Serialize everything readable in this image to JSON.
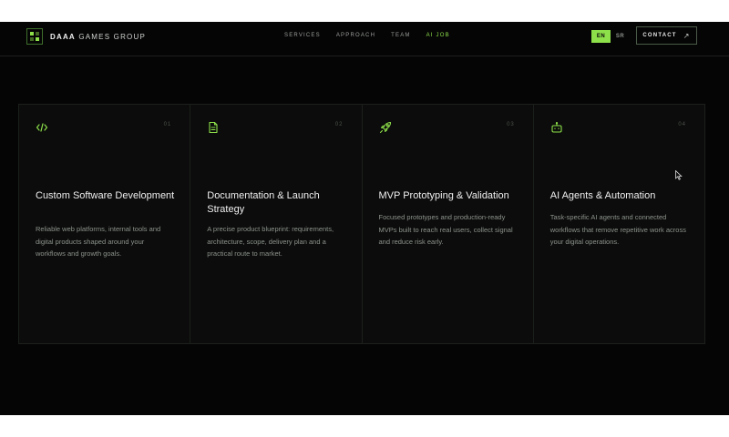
{
  "header": {
    "brand_bold": "DAAA",
    "brand_rest": " GAMES GROUP",
    "nav": [
      "SERVICES",
      "APPROACH",
      "TEAM",
      "AI JOB"
    ],
    "lang": [
      "EN",
      "SR"
    ],
    "contact_label": "CONTACT"
  },
  "cards": [
    {
      "num": "01",
      "icon": "code-icon",
      "title": "Custom Software Development",
      "desc": "Reliable web platforms, internal tools and digital products shaped around your workflows and growth goals."
    },
    {
      "num": "02",
      "icon": "document-icon",
      "title": "Documentation & Launch Strategy",
      "desc": "A precise product blueprint: requirements, architecture, scope, delivery plan and a practical route to market."
    },
    {
      "num": "03",
      "icon": "rocket-icon",
      "title": "MVP Prototyping & Validation",
      "desc": "Focused prototypes and production-ready MVPs built to reach real users, collect signal and reduce risk early."
    },
    {
      "num": "04",
      "icon": "robot-icon",
      "title": "AI Agents & Automation",
      "desc": "Task-specific AI agents and connected workflows that remove repetitive work across your digital operations."
    }
  ],
  "colors": {
    "accent": "#8ee04a",
    "background": "#050505",
    "card": "#0b0c0b"
  }
}
